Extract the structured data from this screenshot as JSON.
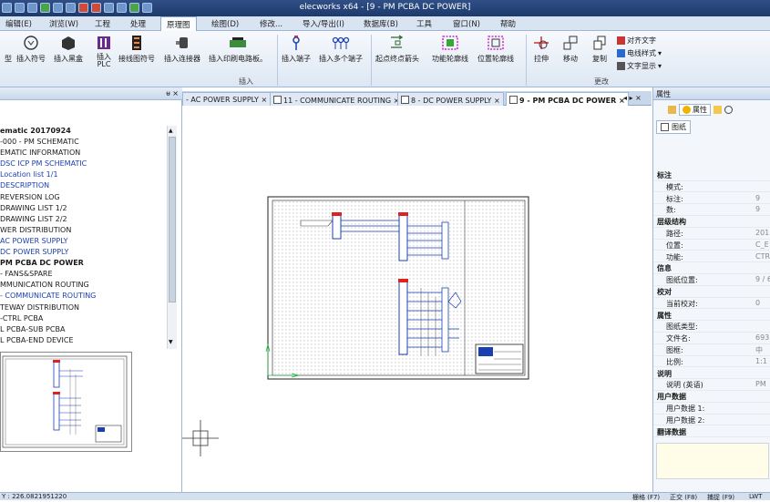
{
  "titlebar": {
    "title": "elecworks x64 - [9 - PM PCBA DC POWER]"
  },
  "menu": [
    "编辑(E)",
    "浏览(W)",
    "工程",
    "处理",
    "原理图",
    "绘图(D)",
    "修改...",
    "导入/导出(I)",
    "数据库(B)",
    "工具",
    "窗口(N)",
    "帮助"
  ],
  "ribbon": {
    "buttons": [
      "型",
      "插入符号",
      "插入黑盒",
      "插入\nPLC",
      "接线图符号",
      "插入连接器",
      "插入印刷电路板。",
      "插入端子",
      "插入多个端子",
      "起点终点箭头",
      "功能轮廓线",
      "位置轮廓线",
      "拉伸",
      "移动",
      "复制"
    ],
    "small": [
      "对齐文字",
      "电线样式",
      "文字显示"
    ],
    "groups": [
      "插入",
      "更改"
    ]
  },
  "left_panel": {
    "pin": "ᵾ ×",
    "tree": [
      {
        "label": "ematic 20170924",
        "style": "bold"
      },
      {
        "label": "-000 - PM SCHEMATIC",
        "style": ""
      },
      {
        "label": "EMATIC INFORMATION",
        "style": ""
      },
      {
        "label": " DSC ICP PM SCHEMATIC",
        "style": "blue"
      },
      {
        "label": " Location list 1/1",
        "style": "blue"
      },
      {
        "label": " DESCRIPTION",
        "style": "blue"
      },
      {
        "label": " REVERSION LOG",
        "style": ""
      },
      {
        "label": " DRAWING LIST 1/2",
        "style": ""
      },
      {
        "label": " DRAWING LIST 2/2",
        "style": ""
      },
      {
        "label": "WER DISTRIBUTION",
        "style": ""
      },
      {
        "label": " AC POWER SUPPLY",
        "style": "blue"
      },
      {
        "label": " DC POWER SUPPLY",
        "style": "blue"
      },
      {
        "label": " PM PCBA DC POWER",
        "style": "bold"
      },
      {
        "label": " - FANS&SPARE",
        "style": ""
      },
      {
        "label": "MMUNICATION ROUTING",
        "style": ""
      },
      {
        "label": " - COMMUNICATE ROUTING",
        "style": "blue"
      },
      {
        "label": "TEWAY DISTRIBUTION",
        "style": ""
      },
      {
        "label": "-CTRL PCBA",
        "style": ""
      },
      {
        "label": "L PCBA-SUB PCBA",
        "style": ""
      },
      {
        "label": "L PCBA-END DEVICE",
        "style": ""
      }
    ]
  },
  "tabs": [
    {
      "label": "- AC POWER SUPPLY",
      "active": false
    },
    {
      "label": "11 - COMMUNICATE ROUTING",
      "active": false
    },
    {
      "label": "8 - DC POWER SUPPLY",
      "active": false
    },
    {
      "label": "9 - PM PCBA DC POWER",
      "active": true
    }
  ],
  "tab_nav": "◂ ▸ ×",
  "properties": {
    "title": "属性",
    "tab_labels": [
      "属性"
    ],
    "sheet_label": "图纸",
    "rows": [
      {
        "k": "标注",
        "v": "",
        "sec": true
      },
      {
        "k": "模式:",
        "v": "",
        "sec": false
      },
      {
        "k": "标注:",
        "v": "9",
        "sec": false
      },
      {
        "k": "数:",
        "v": "9",
        "sec": false
      },
      {
        "k": "层级结构",
        "v": "",
        "sec": true
      },
      {
        "k": "路径:",
        "v": "201",
        "sec": false
      },
      {
        "k": "位置:",
        "v": "C_E",
        "sec": false
      },
      {
        "k": "功能:",
        "v": "CTR",
        "sec": false
      },
      {
        "k": "信息",
        "v": "",
        "sec": true
      },
      {
        "k": "图纸位置:",
        "v": "9 / 6",
        "sec": false
      },
      {
        "k": "校对",
        "v": "",
        "sec": true
      },
      {
        "k": "当前校对:",
        "v": "0",
        "sec": false
      },
      {
        "k": "属性",
        "v": "",
        "sec": true
      },
      {
        "k": "图纸类型:",
        "v": "",
        "sec": false
      },
      {
        "k": "文件名:",
        "v": "693",
        "sec": false
      },
      {
        "k": "图框:",
        "v": "中",
        "sec": false
      },
      {
        "k": "比例:",
        "v": "1:1",
        "sec": false
      },
      {
        "k": "说明",
        "v": "",
        "sec": true
      },
      {
        "k": "说明 (英语)",
        "v": "PM",
        "sec": false
      },
      {
        "k": "用户数据",
        "v": "",
        "sec": true
      },
      {
        "k": "用户数据 1:",
        "v": "",
        "sec": false
      },
      {
        "k": "用户数据 2:",
        "v": "",
        "sec": false
      },
      {
        "k": "翻译数据",
        "v": "",
        "sec": true
      }
    ]
  },
  "status": {
    "coords": "Y : 226.0821951220",
    "toggles": [
      "栅格 (F7)",
      "正交 (F8)",
      "捕捉 (F9)",
      "LWT"
    ]
  },
  "colors": {
    "accent": "#1e3a6c",
    "ribbon": "#dde7f3",
    "wire": "#1a3fb0"
  }
}
